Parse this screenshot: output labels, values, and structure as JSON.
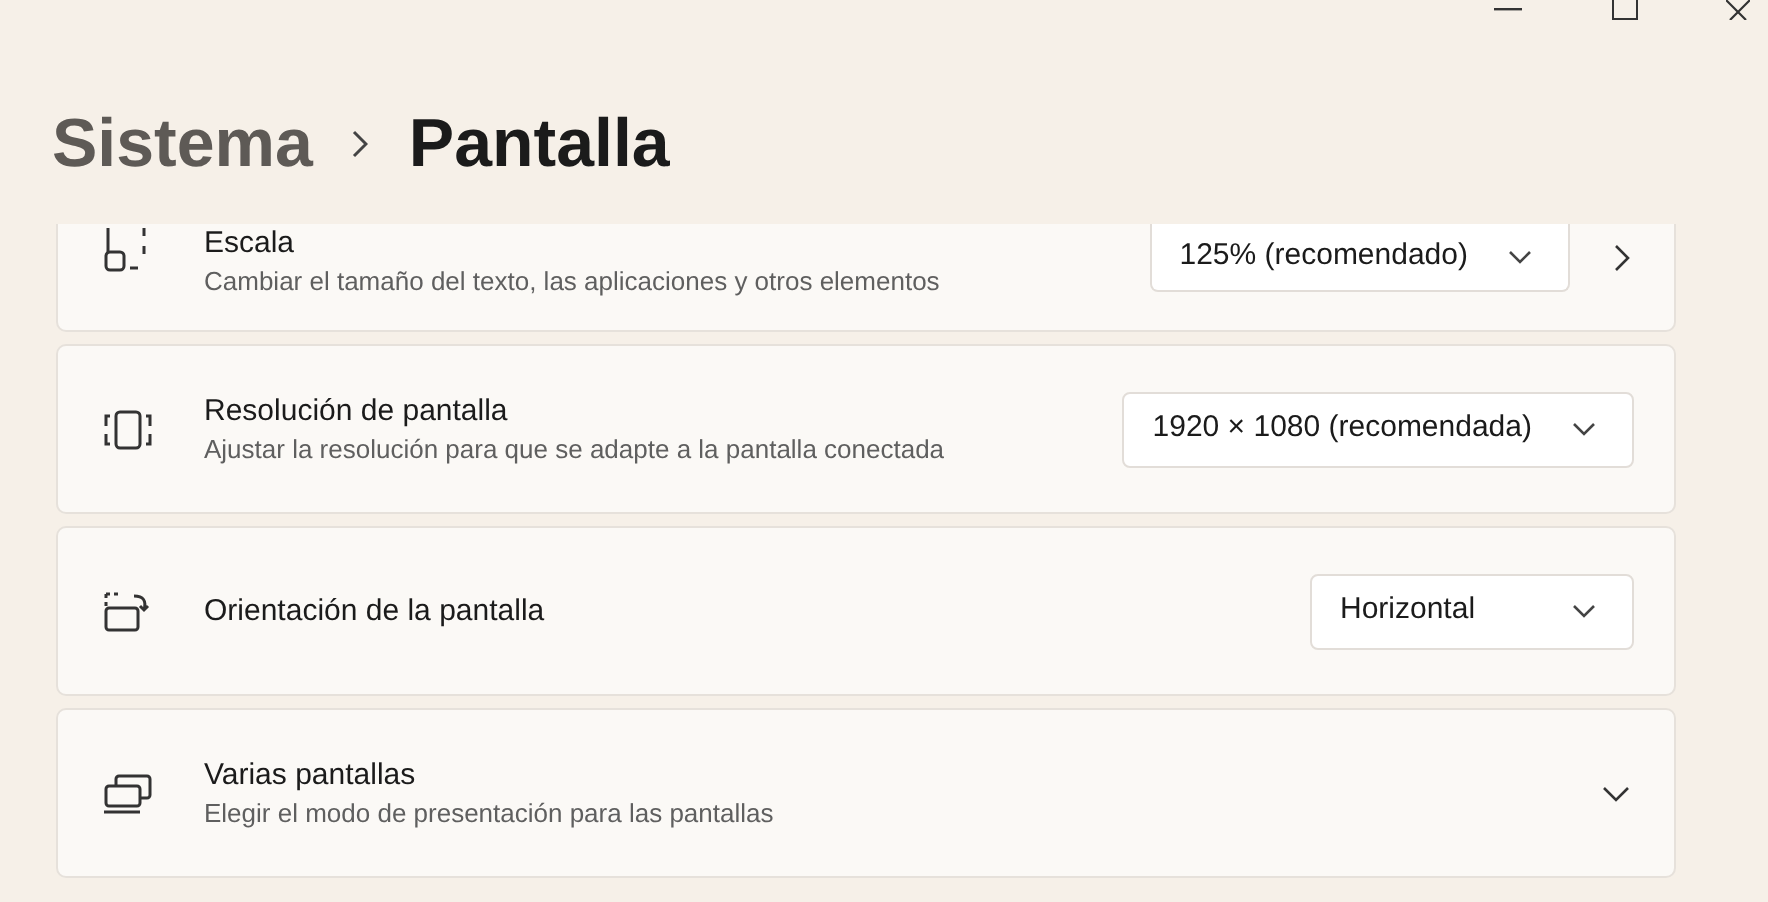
{
  "breadcrumb": {
    "parent": "Sistema",
    "current": "Pantalla"
  },
  "settings": [
    {
      "title": "Escala",
      "subtitle": "Cambiar el tamaño del texto, las aplicaciones y otros elementos",
      "dropdown": "125% (recomendado)",
      "navigates": true
    },
    {
      "title": "Resolución de pantalla",
      "subtitle": "Ajustar la resolución para que se adapte a la pantalla conectada",
      "dropdown": "1920 × 1080 (recomendada)"
    },
    {
      "title": "Orientación de la pantalla",
      "dropdown": "Horizontal"
    },
    {
      "title": "Varias pantallas",
      "subtitle": "Elegir el modo de presentación para las pantallas",
      "expanded": false
    }
  ]
}
